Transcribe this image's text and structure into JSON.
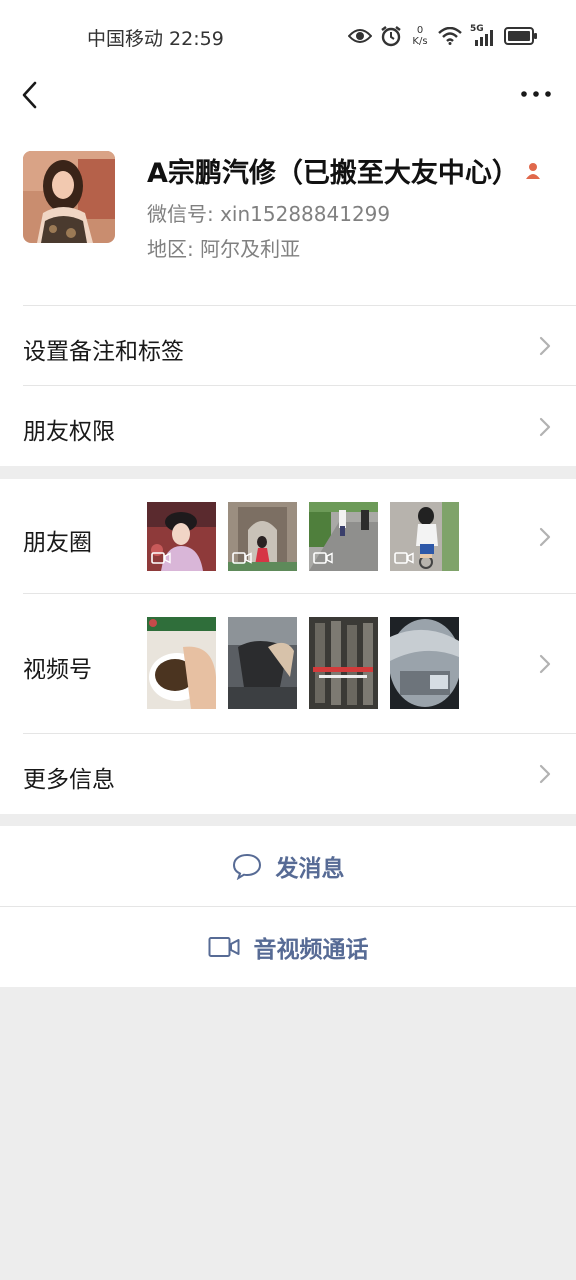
{
  "status_bar": {
    "carrier_time": "中国移动 22:59",
    "speed_value": "0",
    "speed_unit": "K/s",
    "network": "5G"
  },
  "profile": {
    "name": "A宗鹏汽修（已搬至大友中心）",
    "wechat_id": "微信号: xin15288841299",
    "region": "地区: 阿尔及利亚"
  },
  "menu": {
    "remark_label": "设置备注和标签",
    "permission_label": "朋友权限",
    "moments_label": "朋友圈",
    "channels_label": "视频号",
    "more_info_label": "更多信息"
  },
  "actions": {
    "message_label": "发消息",
    "call_label": "音视频通话"
  },
  "colors": {
    "link_blue": "#576b95",
    "background_gray": "#ededed"
  }
}
